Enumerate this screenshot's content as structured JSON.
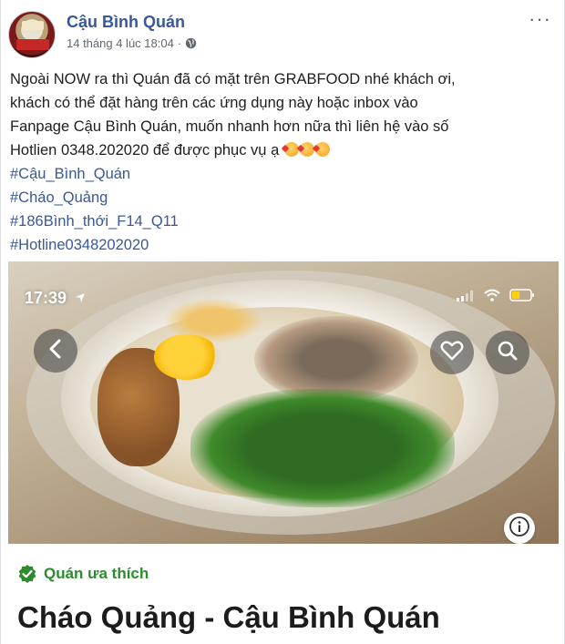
{
  "post": {
    "page_name": "Cậu Bình Quán",
    "timestamp": "14 tháng 4 lúc 18:04",
    "separator": "·",
    "more_label": "···",
    "text_lines": [
      "Ngoài NOW ra thì Quán đã có mặt trên GRABFOOD nhé khách ơi,",
      "khách có thể đặt hàng trên các ứng dụng này hoặc inbox vào",
      "Fanpage Cậu Bình Quán, muốn nhanh hơn nữa thì liên hệ vào số",
      "Hotlien 0348.202020 để được phục vụ ạ"
    ],
    "hashtags": [
      "#Cậu_Bình_Quán",
      "#Cháo_Quảng",
      "#186Bình_thới_F14_Q11",
      "#Hotline0348202020"
    ]
  },
  "photo": {
    "status_time": "17:39"
  },
  "app_card": {
    "badge_label": "Quán ưa thích",
    "restaurant_title": "Cháo Quảng - Cậu Bình Quán"
  },
  "icons": {
    "globe": "globe-icon",
    "back": "chevron-left-icon",
    "heart": "heart-icon",
    "search": "search-icon",
    "info": "info-icon",
    "check": "check-circle-icon"
  },
  "colors": {
    "link": "#385898",
    "badge_green": "#2e8b2e",
    "text": "#1c1e21",
    "meta": "#606770"
  }
}
